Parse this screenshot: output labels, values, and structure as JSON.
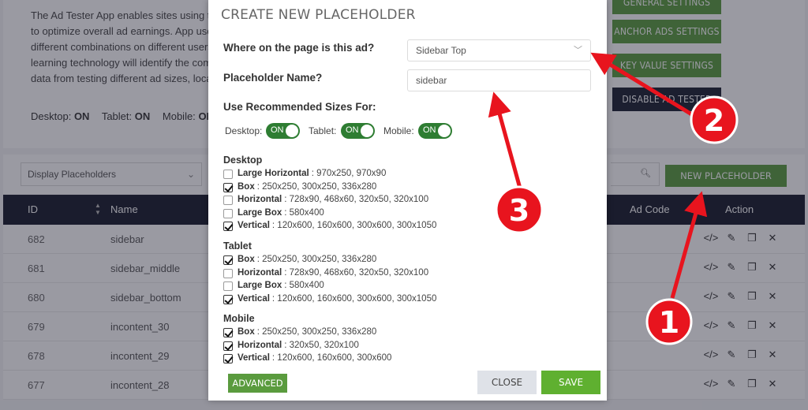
{
  "background": {
    "description_lines": [
      "The Ad Tester App enables sites using the",
      "to optimize overall ad earnings. App users",
      "different combinations on different users",
      "learning technology will identify the comb",
      "data from testing different ad sizes, locati"
    ],
    "device_status": {
      "desktop_label": "Desktop:",
      "desktop_value": "ON",
      "tablet_label": "Tablet:",
      "tablet_value": "ON",
      "mobile_label": "Mobile:",
      "mobile_value": "ON"
    },
    "side_buttons": {
      "general": "GENERAL SETTINGS",
      "anchor": "ANCHOR ADS SETTINGS",
      "key_value": "KEY VALUE SETTINGS",
      "disable": "DISABLE AD TESTER"
    },
    "filter": {
      "display_select": "Display Placeholders",
      "new_placeholder": "NEW PLACEHOLDER"
    },
    "table": {
      "headers": {
        "id": "ID",
        "name": "Name",
        "ad_code": "Ad Code",
        "action": "Action"
      },
      "rows": [
        {
          "id": "682",
          "name": "sidebar"
        },
        {
          "id": "681",
          "name": "sidebar_middle"
        },
        {
          "id": "680",
          "name": "sidebar_bottom"
        },
        {
          "id": "679",
          "name": "incontent_30"
        },
        {
          "id": "678",
          "name": "incontent_29"
        },
        {
          "id": "677",
          "name": "incontent_28"
        }
      ]
    }
  },
  "modal": {
    "title": "CREATE NEW PLACEHOLDER",
    "location_label": "Where on the page is this ad?",
    "location_value": "Sidebar Top",
    "name_label": "Placeholder Name?",
    "name_value": "sidebar",
    "recommended_label": "Use Recommended Sizes For:",
    "toggles": {
      "desktop_label": "Desktop:",
      "tablet_label": "Tablet:",
      "mobile_label": "Mobile:",
      "state": "ON"
    },
    "groups": {
      "desktop": {
        "title": "Desktop",
        "options": [
          {
            "name": "Large Horizontal",
            "sizes": ": 970x250, 970x90",
            "checked": false
          },
          {
            "name": "Box",
            "sizes": ": 250x250, 300x250, 336x280",
            "checked": true
          },
          {
            "name": "Horizontal",
            "sizes": ": 728x90, 468x60, 320x50, 320x100",
            "checked": false
          },
          {
            "name": "Large Box",
            "sizes": ": 580x400",
            "checked": false
          },
          {
            "name": "Vertical",
            "sizes": ": 120x600, 160x600, 300x600, 300x1050",
            "checked": true
          }
        ]
      },
      "tablet": {
        "title": "Tablet",
        "options": [
          {
            "name": "Box",
            "sizes": ": 250x250, 300x250, 336x280",
            "checked": true
          },
          {
            "name": "Horizontal",
            "sizes": ": 728x90, 468x60, 320x50, 320x100",
            "checked": false
          },
          {
            "name": "Large Box",
            "sizes": ": 580x400",
            "checked": false
          },
          {
            "name": "Vertical",
            "sizes": ": 120x600, 160x600, 300x600, 300x1050",
            "checked": true
          }
        ]
      },
      "mobile": {
        "title": "Mobile",
        "options": [
          {
            "name": "Box",
            "sizes": ": 250x250, 300x250, 336x280",
            "checked": true
          },
          {
            "name": "Horizontal",
            "sizes": ": 320x50, 320x100",
            "checked": true
          },
          {
            "name": "Vertical",
            "sizes": ": 120x600, 160x600, 300x600",
            "checked": true
          }
        ]
      }
    },
    "buttons": {
      "advanced": "ADVANCED",
      "close": "CLOSE",
      "save": "SAVE"
    }
  },
  "annotations": {
    "badge_1": "1",
    "badge_2": "2",
    "badge_3": "3",
    "color": "#e8141e"
  },
  "colors": {
    "accent_green": "#5a9b3e",
    "toggle_green": "#2e7d32",
    "save_green": "#5fb030",
    "header_dark": "#161b2a"
  }
}
